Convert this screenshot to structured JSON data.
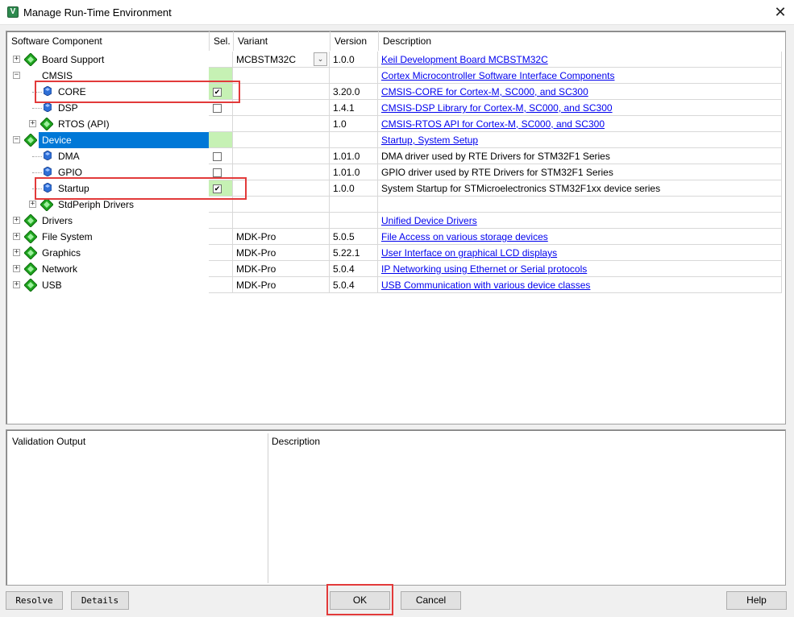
{
  "window": {
    "title": "Manage Run-Time Environment",
    "app_icon": "V"
  },
  "table": {
    "headers": {
      "component": "Software Component",
      "sel": "Sel.",
      "variant": "Variant",
      "version": "Version",
      "description": "Description"
    },
    "rows": [
      {
        "label": "Board Support",
        "variant": "MCBSTM32C",
        "version": "1.0.0",
        "description": "Keil Development Board MCBSTM32C",
        "link": true
      },
      {
        "label": "CMSIS",
        "variant": "",
        "version": "",
        "description": "Cortex Microcontroller Software Interface Components",
        "link": true
      },
      {
        "label": "CORE",
        "variant": "",
        "version": "3.20.0",
        "description": "CMSIS-CORE for Cortex-M, SC000, and SC300",
        "link": true,
        "checked": true
      },
      {
        "label": "DSP",
        "variant": "",
        "version": "1.4.1",
        "description": "CMSIS-DSP Library for Cortex-M, SC000, and SC300",
        "link": true,
        "checked": false
      },
      {
        "label": "RTOS (API)",
        "variant": "",
        "version": "1.0",
        "description": "CMSIS-RTOS API for Cortex-M, SC000, and SC300",
        "link": true
      },
      {
        "label": "Device",
        "variant": "",
        "version": "",
        "description": "Startup, System Setup",
        "link": true
      },
      {
        "label": "DMA",
        "variant": "",
        "version": "1.01.0",
        "description": "DMA driver used by RTE Drivers for STM32F1 Series",
        "link": false,
        "checked": false
      },
      {
        "label": "GPIO",
        "variant": "",
        "version": "1.01.0",
        "description": "GPIO driver used by RTE Drivers for STM32F1 Series",
        "link": false,
        "checked": false
      },
      {
        "label": "Startup",
        "variant": "",
        "version": "1.0.0",
        "description": "System Startup for STMicroelectronics STM32F1xx device series",
        "link": false,
        "checked": true
      },
      {
        "label": "StdPeriph Drivers",
        "variant": "",
        "version": "",
        "description": "",
        "link": false
      },
      {
        "label": "Drivers",
        "variant": "",
        "version": "",
        "description": "Unified Device Drivers",
        "link": true
      },
      {
        "label": "File System",
        "variant": "MDK-Pro",
        "version": "5.0.5",
        "description": "File Access on various storage devices",
        "link": true
      },
      {
        "label": "Graphics",
        "variant": "MDK-Pro",
        "version": "5.22.1",
        "description": "User Interface on graphical LCD displays",
        "link": true
      },
      {
        "label": "Network",
        "variant": "MDK-Pro",
        "version": "5.0.4",
        "description": "IP Networking using Ethernet or Serial protocols",
        "link": true
      },
      {
        "label": "USB",
        "variant": "MDK-Pro",
        "version": "5.0.4",
        "description": "USB Communication with various device classes",
        "link": true
      }
    ]
  },
  "bottom": {
    "validation_header": "Validation Output",
    "description_header": "Description"
  },
  "buttons": {
    "resolve": "Resolve",
    "details": "Details",
    "ok": "OK",
    "cancel": "Cancel",
    "help": "Help"
  },
  "colors": {
    "selection": "#0078d7",
    "sel_green": "#c6f1b4",
    "link": "#0000ee",
    "highlight_box": "#e23a3a",
    "diamond": "#1fa51f"
  }
}
